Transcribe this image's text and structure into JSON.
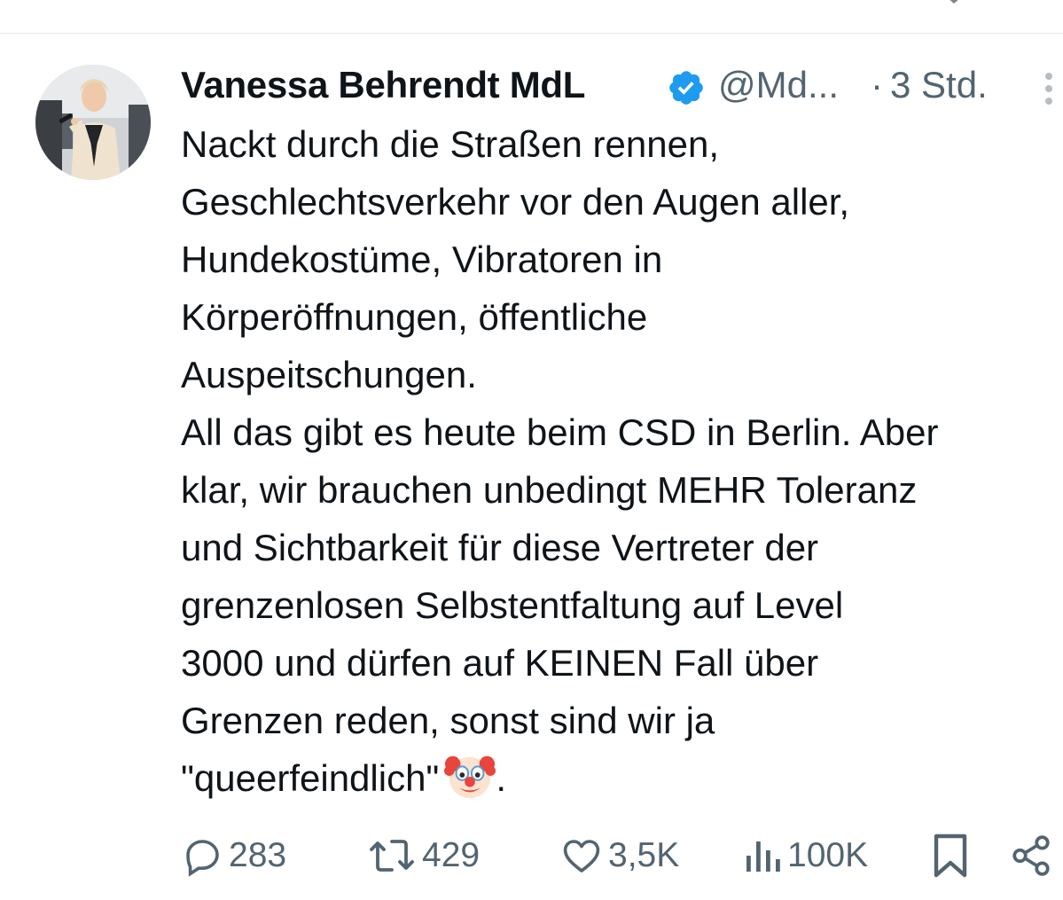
{
  "tweet": {
    "author_name": "Vanessa Behrendt MdL",
    "handle": "@Md...",
    "separator": "·",
    "time": "3 Std.",
    "text_lines": [
      "Nackt durch die Straßen rennen,",
      "Geschlechtsverkehr vor den Augen aller,",
      "Hundekostüme, Vibratoren in",
      "Körperöffnungen, öffentliche",
      "Auspeitschungen.",
      "All das gibt es heute beim CSD in Berlin. Aber",
      "klar, wir brauchen unbedingt MEHR Toleranz",
      "und Sichtbarkeit für diese Vertreter der",
      "grenzenlosen Selbstentfaltung auf Level",
      "3000 und dürfen auf KEINEN Fall über",
      "Grenzen reden, sonst sind wir ja"
    ],
    "last_line_text": "\"queerfeindlich\"",
    "last_line_end": ".",
    "emoji": "clown-face"
  },
  "actions": {
    "replies": "283",
    "reposts": "429",
    "likes": "3,5K",
    "views": "100K"
  },
  "icons": {
    "verified": "verified-badge-icon",
    "more": "more-options-icon",
    "reply": "reply-icon",
    "repost": "repost-icon",
    "like": "heart-icon",
    "views": "views-chart-icon",
    "bookmark": "bookmark-icon",
    "share": "share-icon"
  },
  "colors": {
    "text": "#0f1419",
    "secondary": "#536471",
    "verified": "#1d9bf0",
    "divider": "#e4e8eb"
  }
}
